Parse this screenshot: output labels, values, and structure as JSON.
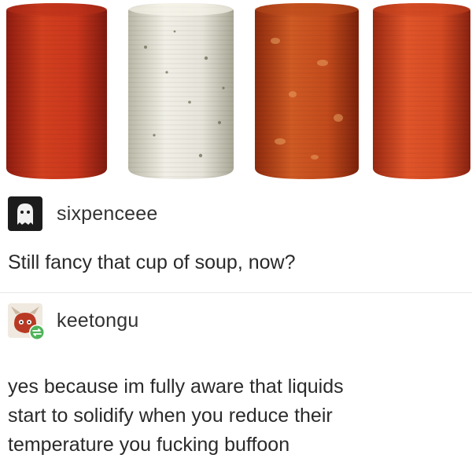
{
  "photo": {
    "subject": "four-cylinders-of-solidified-soup",
    "colors": [
      "#c8321e",
      "#e4e2d6",
      "#c4441a",
      "#d24422"
    ]
  },
  "posts": [
    {
      "username": "sixpenceee",
      "avatar_icon": "ghost-avatar-icon",
      "text": "Still fancy that cup of soup, now?"
    },
    {
      "username": "keetongu",
      "avatar_icon": "cartoon-avatar-icon",
      "reblog_icon": "reblog-icon",
      "text": "yes because im fully aware that liquids\nstart to solidify when you reduce their\ntemperature you fucking buffoon"
    }
  ]
}
